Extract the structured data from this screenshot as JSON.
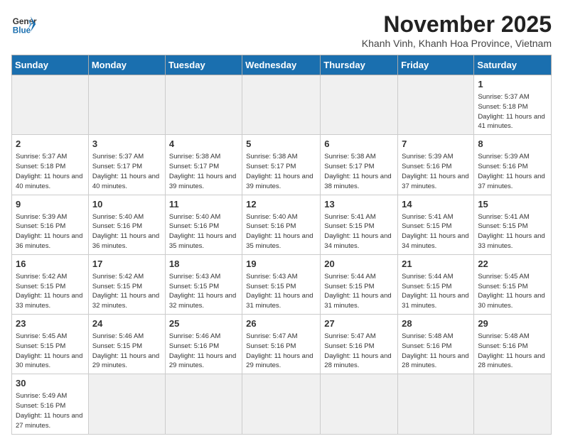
{
  "header": {
    "logo_general": "General",
    "logo_blue": "Blue",
    "month_title": "November 2025",
    "subtitle": "Khanh Vinh, Khanh Hoa Province, Vietnam"
  },
  "weekdays": [
    "Sunday",
    "Monday",
    "Tuesday",
    "Wednesday",
    "Thursday",
    "Friday",
    "Saturday"
  ],
  "weeks": [
    [
      {
        "day": "",
        "info": ""
      },
      {
        "day": "",
        "info": ""
      },
      {
        "day": "",
        "info": ""
      },
      {
        "day": "",
        "info": ""
      },
      {
        "day": "",
        "info": ""
      },
      {
        "day": "",
        "info": ""
      },
      {
        "day": "1",
        "info": "Sunrise: 5:37 AM\nSunset: 5:18 PM\nDaylight: 11 hours and 41 minutes."
      }
    ],
    [
      {
        "day": "2",
        "info": "Sunrise: 5:37 AM\nSunset: 5:18 PM\nDaylight: 11 hours and 40 minutes."
      },
      {
        "day": "3",
        "info": "Sunrise: 5:37 AM\nSunset: 5:17 PM\nDaylight: 11 hours and 40 minutes."
      },
      {
        "day": "4",
        "info": "Sunrise: 5:38 AM\nSunset: 5:17 PM\nDaylight: 11 hours and 39 minutes."
      },
      {
        "day": "5",
        "info": "Sunrise: 5:38 AM\nSunset: 5:17 PM\nDaylight: 11 hours and 39 minutes."
      },
      {
        "day": "6",
        "info": "Sunrise: 5:38 AM\nSunset: 5:17 PM\nDaylight: 11 hours and 38 minutes."
      },
      {
        "day": "7",
        "info": "Sunrise: 5:39 AM\nSunset: 5:16 PM\nDaylight: 11 hours and 37 minutes."
      },
      {
        "day": "8",
        "info": "Sunrise: 5:39 AM\nSunset: 5:16 PM\nDaylight: 11 hours and 37 minutes."
      }
    ],
    [
      {
        "day": "9",
        "info": "Sunrise: 5:39 AM\nSunset: 5:16 PM\nDaylight: 11 hours and 36 minutes."
      },
      {
        "day": "10",
        "info": "Sunrise: 5:40 AM\nSunset: 5:16 PM\nDaylight: 11 hours and 36 minutes."
      },
      {
        "day": "11",
        "info": "Sunrise: 5:40 AM\nSunset: 5:16 PM\nDaylight: 11 hours and 35 minutes."
      },
      {
        "day": "12",
        "info": "Sunrise: 5:40 AM\nSunset: 5:16 PM\nDaylight: 11 hours and 35 minutes."
      },
      {
        "day": "13",
        "info": "Sunrise: 5:41 AM\nSunset: 5:15 PM\nDaylight: 11 hours and 34 minutes."
      },
      {
        "day": "14",
        "info": "Sunrise: 5:41 AM\nSunset: 5:15 PM\nDaylight: 11 hours and 34 minutes."
      },
      {
        "day": "15",
        "info": "Sunrise: 5:41 AM\nSunset: 5:15 PM\nDaylight: 11 hours and 33 minutes."
      }
    ],
    [
      {
        "day": "16",
        "info": "Sunrise: 5:42 AM\nSunset: 5:15 PM\nDaylight: 11 hours and 33 minutes."
      },
      {
        "day": "17",
        "info": "Sunrise: 5:42 AM\nSunset: 5:15 PM\nDaylight: 11 hours and 32 minutes."
      },
      {
        "day": "18",
        "info": "Sunrise: 5:43 AM\nSunset: 5:15 PM\nDaylight: 11 hours and 32 minutes."
      },
      {
        "day": "19",
        "info": "Sunrise: 5:43 AM\nSunset: 5:15 PM\nDaylight: 11 hours and 31 minutes."
      },
      {
        "day": "20",
        "info": "Sunrise: 5:44 AM\nSunset: 5:15 PM\nDaylight: 11 hours and 31 minutes."
      },
      {
        "day": "21",
        "info": "Sunrise: 5:44 AM\nSunset: 5:15 PM\nDaylight: 11 hours and 31 minutes."
      },
      {
        "day": "22",
        "info": "Sunrise: 5:45 AM\nSunset: 5:15 PM\nDaylight: 11 hours and 30 minutes."
      }
    ],
    [
      {
        "day": "23",
        "info": "Sunrise: 5:45 AM\nSunset: 5:15 PM\nDaylight: 11 hours and 30 minutes."
      },
      {
        "day": "24",
        "info": "Sunrise: 5:46 AM\nSunset: 5:15 PM\nDaylight: 11 hours and 29 minutes."
      },
      {
        "day": "25",
        "info": "Sunrise: 5:46 AM\nSunset: 5:16 PM\nDaylight: 11 hours and 29 minutes."
      },
      {
        "day": "26",
        "info": "Sunrise: 5:47 AM\nSunset: 5:16 PM\nDaylight: 11 hours and 29 minutes."
      },
      {
        "day": "27",
        "info": "Sunrise: 5:47 AM\nSunset: 5:16 PM\nDaylight: 11 hours and 28 minutes."
      },
      {
        "day": "28",
        "info": "Sunrise: 5:48 AM\nSunset: 5:16 PM\nDaylight: 11 hours and 28 minutes."
      },
      {
        "day": "29",
        "info": "Sunrise: 5:48 AM\nSunset: 5:16 PM\nDaylight: 11 hours and 28 minutes."
      }
    ],
    [
      {
        "day": "30",
        "info": "Sunrise: 5:49 AM\nSunset: 5:16 PM\nDaylight: 11 hours and 27 minutes."
      },
      {
        "day": "",
        "info": ""
      },
      {
        "day": "",
        "info": ""
      },
      {
        "day": "",
        "info": ""
      },
      {
        "day": "",
        "info": ""
      },
      {
        "day": "",
        "info": ""
      },
      {
        "day": "",
        "info": ""
      }
    ]
  ]
}
